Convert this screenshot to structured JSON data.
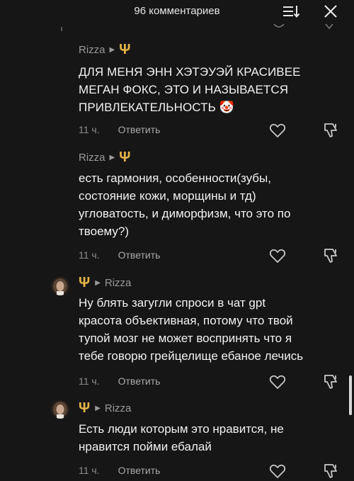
{
  "header": {
    "title": "96 комментариев",
    "sort_icon": "sort-icon",
    "close_icon": "close-icon"
  },
  "comments": [
    {
      "username": "Rizza",
      "trident": "Ψ",
      "text_lines": [
        "ДЛЯ МЕНЯ ЭНН ХЭТЭУЭЙ КРАСИВЕЕ",
        "МЕГАН ФОКС, ЭТО И НАЗЫВАЕТСЯ",
        "ПРИВЛЕКАТЕЛЬНОСТЬ 🤡"
      ],
      "time": "11 ч.",
      "reply": "Ответить"
    },
    {
      "username": "Rizza",
      "trident": "Ψ",
      "text_lines": [
        "есть гармония, особенности(зубы,",
        "состояние кожи, морщины и тд)",
        "угловатость, и диморфизм, что это по",
        "твоему?)"
      ],
      "time": "11 ч.",
      "reply": "Ответить"
    },
    {
      "reply_to": "Rizza",
      "trident": "Ψ",
      "text_lines": [
        "Ну блять загугли спроси в чат gpt",
        "красота объективная, потому что твой",
        "тупой мозг не может воспринять что я",
        "тебе говорю грейцелище ебаное лечись"
      ],
      "time": "11 ч.",
      "reply": "Ответить"
    },
    {
      "reply_to": "Rizza",
      "trident": "Ψ",
      "text_lines": [
        "Есть люди которым это нравится, не",
        "нравится пойми ебалай"
      ],
      "time": "11 ч.",
      "reply": "Ответить"
    }
  ],
  "colors": {
    "background": "#161616",
    "text": "#f2f2f2",
    "muted": "#9a9a9a",
    "trident": "#e6b44a"
  }
}
